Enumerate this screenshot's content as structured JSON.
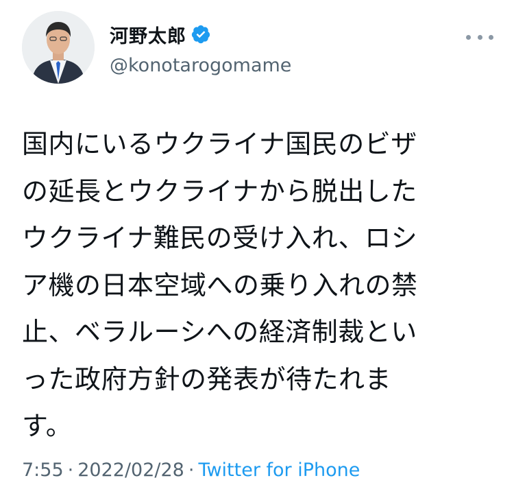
{
  "header": {
    "display_name": "河野太郎",
    "handle": "@konotarogomame",
    "verified_icon": "verified-badge-icon",
    "more_icon": "more-dots-icon"
  },
  "tweet": {
    "text": "国内にいるウクライナ国民のビザ\nの延長とウクライナから脱出した\nウクライナ難民の受け入れ、ロシ\nア機の日本空域への乗り入れの禁\n止、ベラルーシへの経済制裁とい\nった政府方針の発表が待たれま\nす。"
  },
  "meta": {
    "time": "7:55",
    "separator": "·",
    "date": "2022/02/28",
    "source": "Twitter for iPhone"
  },
  "colors": {
    "text": "#0f1419",
    "secondary": "#536471",
    "accent": "#1d9bf0"
  }
}
